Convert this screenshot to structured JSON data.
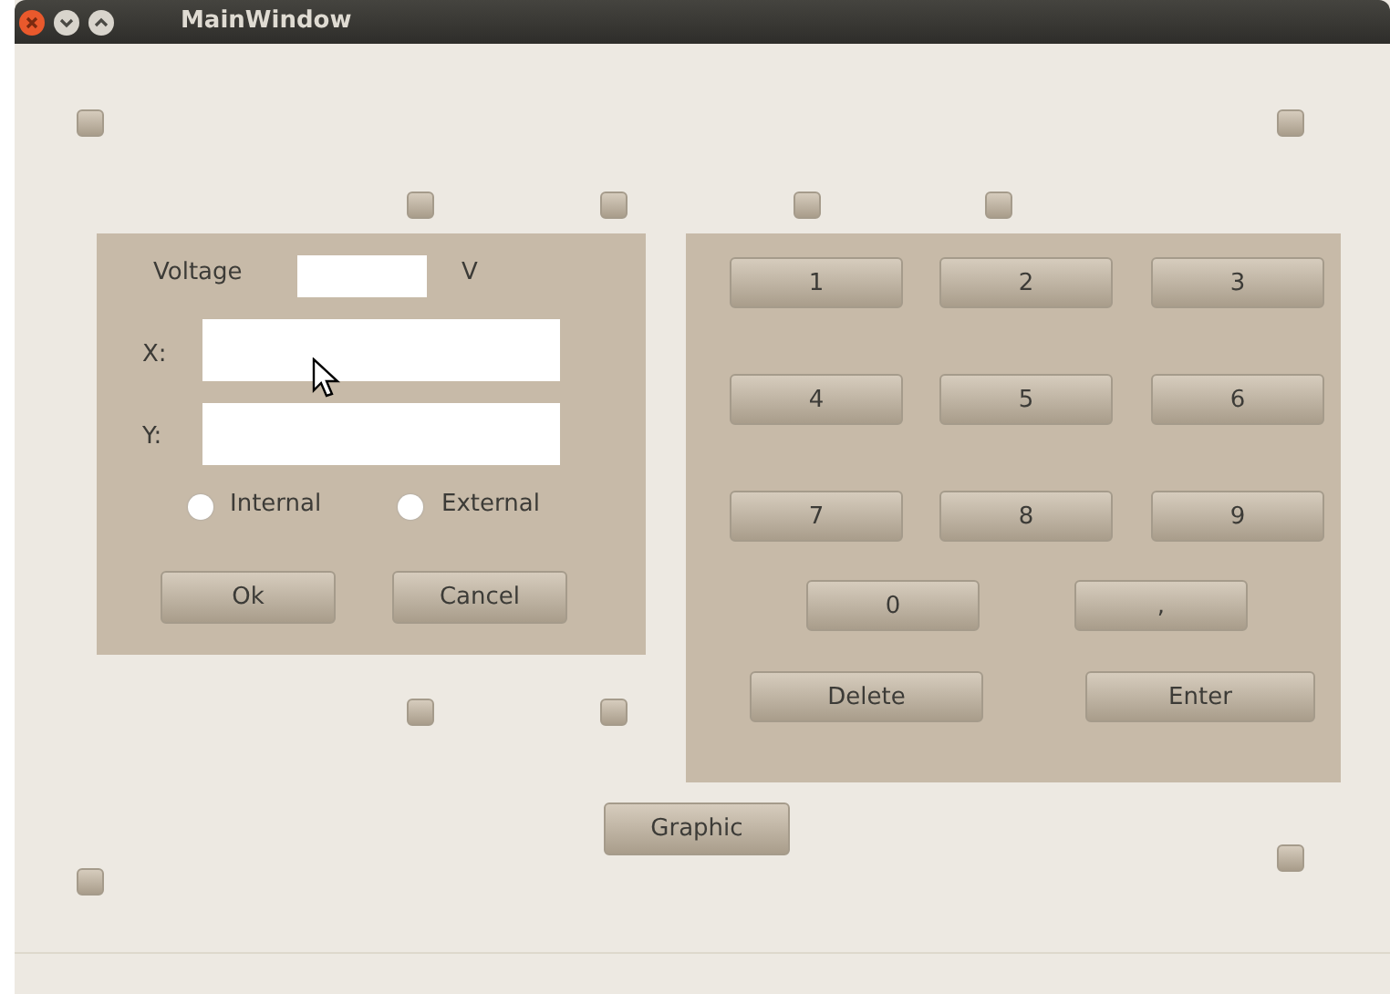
{
  "window": {
    "title": "MainWindow"
  },
  "input_panel": {
    "voltage_label": "Voltage",
    "voltage_unit": "V",
    "x_label": "X:",
    "y_label": "Y:",
    "radios": [
      {
        "label": "Internal",
        "selected": false
      },
      {
        "label": "External",
        "selected": false
      }
    ],
    "buttons": [
      "Ok",
      "Cancel"
    ]
  },
  "keypad": {
    "keys": [
      "1",
      "2",
      "3",
      "4",
      "5",
      "6",
      "7",
      "8",
      "9",
      "0",
      ","
    ],
    "actions": [
      "Delete",
      "Enter"
    ]
  },
  "graphic_button": "Graphic"
}
